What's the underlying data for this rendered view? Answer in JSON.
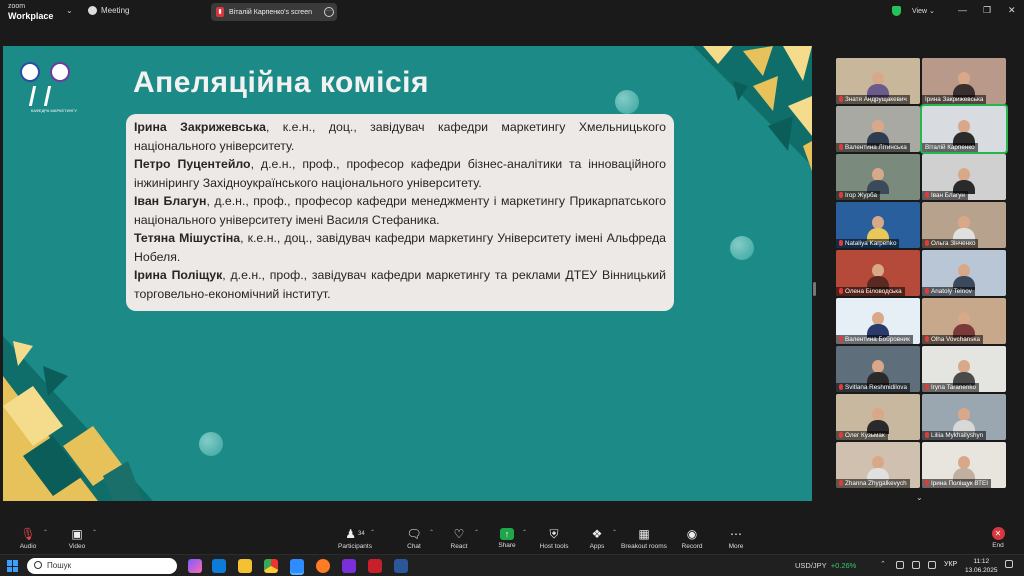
{
  "app": {
    "brand_top": "zoom",
    "brand_bottom": "Workplace",
    "meeting_label": "Meeting",
    "share_title": "Віталій Карпенко's screen",
    "view_label": "View"
  },
  "slide": {
    "title": "Апеляційна комісія",
    "logo_caption": "КАФЕДРА МАРКЕТИНГУ",
    "members": [
      {
        "name": "Ірина Закрижевська",
        "desc": ", к.е.н., доц., завідувач кафедри маркетингу Хмельницького національного університету."
      },
      {
        "name": "Петро Пуцентейло",
        "desc": ", д.е.н., проф., професор кафедри бізнес-аналітики та інноваційного інжинірингу Західноукраїнського національного університету."
      },
      {
        "name": "Іван Благун",
        "desc": ", д.е.н., проф., професор кафедри менеджменту і маркетингу Прикарпатського національного університету імені Василя Стефаника."
      },
      {
        "name": "Тетяна Мішустіна",
        "desc": ", к.е.н., доц., завідувач кафедри маркетингу Університету імені Альфреда Нобеля."
      },
      {
        "name": "Ірина Поліщук",
        "desc": ", д.е.н., проф., завідувач кафедри маркетингу та реклами ДТЕУ Вінницький торговельно-економічний інститут."
      }
    ]
  },
  "participants": [
    {
      "name": "Знатя Андрущакевич",
      "bg": "#c9b79c",
      "shirt": "#6b5a8a",
      "muted": true
    },
    {
      "name": "Ірина Закрижевська",
      "bg": "#b99a8a",
      "shirt": "#3a2f2f",
      "muted": false
    },
    {
      "name": "Валентина Літинська",
      "bg": "#a9a9a3",
      "shirt": "#2f3b4f",
      "muted": true
    },
    {
      "name": "Віталій Карпенко",
      "bg": "#d8dbe0",
      "shirt": "#2b2b2b",
      "muted": false,
      "active": true
    },
    {
      "name": "Ігор Журба",
      "bg": "#7a8a7c",
      "shirt": "#3b4a5a",
      "muted": true
    },
    {
      "name": "Іван Благун",
      "bg": "#d0d0d0",
      "shirt": "#2a2a2a",
      "muted": true
    },
    {
      "name": "Nataliya Karpenko",
      "bg": "#2a5f9e",
      "shirt": "#e8c85a",
      "muted": true
    },
    {
      "name": "Ольга Зінченко",
      "bg": "#b7a38d",
      "shirt": "#e0e0e0",
      "muted": true
    },
    {
      "name": "Олена Біловодська",
      "bg": "#b64a3a",
      "shirt": "#5a2a22",
      "muted": true
    },
    {
      "name": "Anatoly Telnov",
      "bg": "#b9c6d6",
      "shirt": "#3a4a5a",
      "muted": true
    },
    {
      "name": "Валентина Бобровник",
      "bg": "#e6eef6",
      "shirt": "#2a3a6a",
      "muted": true
    },
    {
      "name": "Olha Vovchanska",
      "bg": "#c8a88a",
      "shirt": "#7a3a3a",
      "muted": true
    },
    {
      "name": "Svitlana Reshmidilova",
      "bg": "#5e6e7a",
      "shirt": "#2a2a2a",
      "muted": true
    },
    {
      "name": "Iryna Taranenko",
      "bg": "#e4e4e0",
      "shirt": "#4a4a4a",
      "muted": true
    },
    {
      "name": "Олег Кузьмак",
      "bg": "#c8b8a0",
      "shirt": "#2a2a2a",
      "muted": true
    },
    {
      "name": "Liliia Mykhailyshyn",
      "bg": "#9aa6b0",
      "shirt": "#d8d8d8",
      "muted": true
    },
    {
      "name": "Zhanna Zhygalkevych",
      "bg": "#d0c0b0",
      "shirt": "#e0e0e0",
      "muted": true
    },
    {
      "name": "Ірина Поліщук ВТЕІ",
      "bg": "#e8e4de",
      "shirt": "#c0b0a0",
      "muted": true
    }
  ],
  "controls": {
    "audio": "Audio",
    "video": "Video",
    "participants": "Participants",
    "participants_count": "34",
    "chat": "Chat",
    "react": "React",
    "share": "Share",
    "host_tools": "Host tools",
    "apps": "Apps",
    "breakout": "Breakout rooms",
    "record": "Record",
    "more": "More",
    "end": "End"
  },
  "taskbar": {
    "search_placeholder": "Пошук",
    "ticker_symbol": "USD/JPY",
    "ticker_change": "+0.26%",
    "language": "УКР",
    "time": "11:12",
    "date": "13.06.2025"
  }
}
